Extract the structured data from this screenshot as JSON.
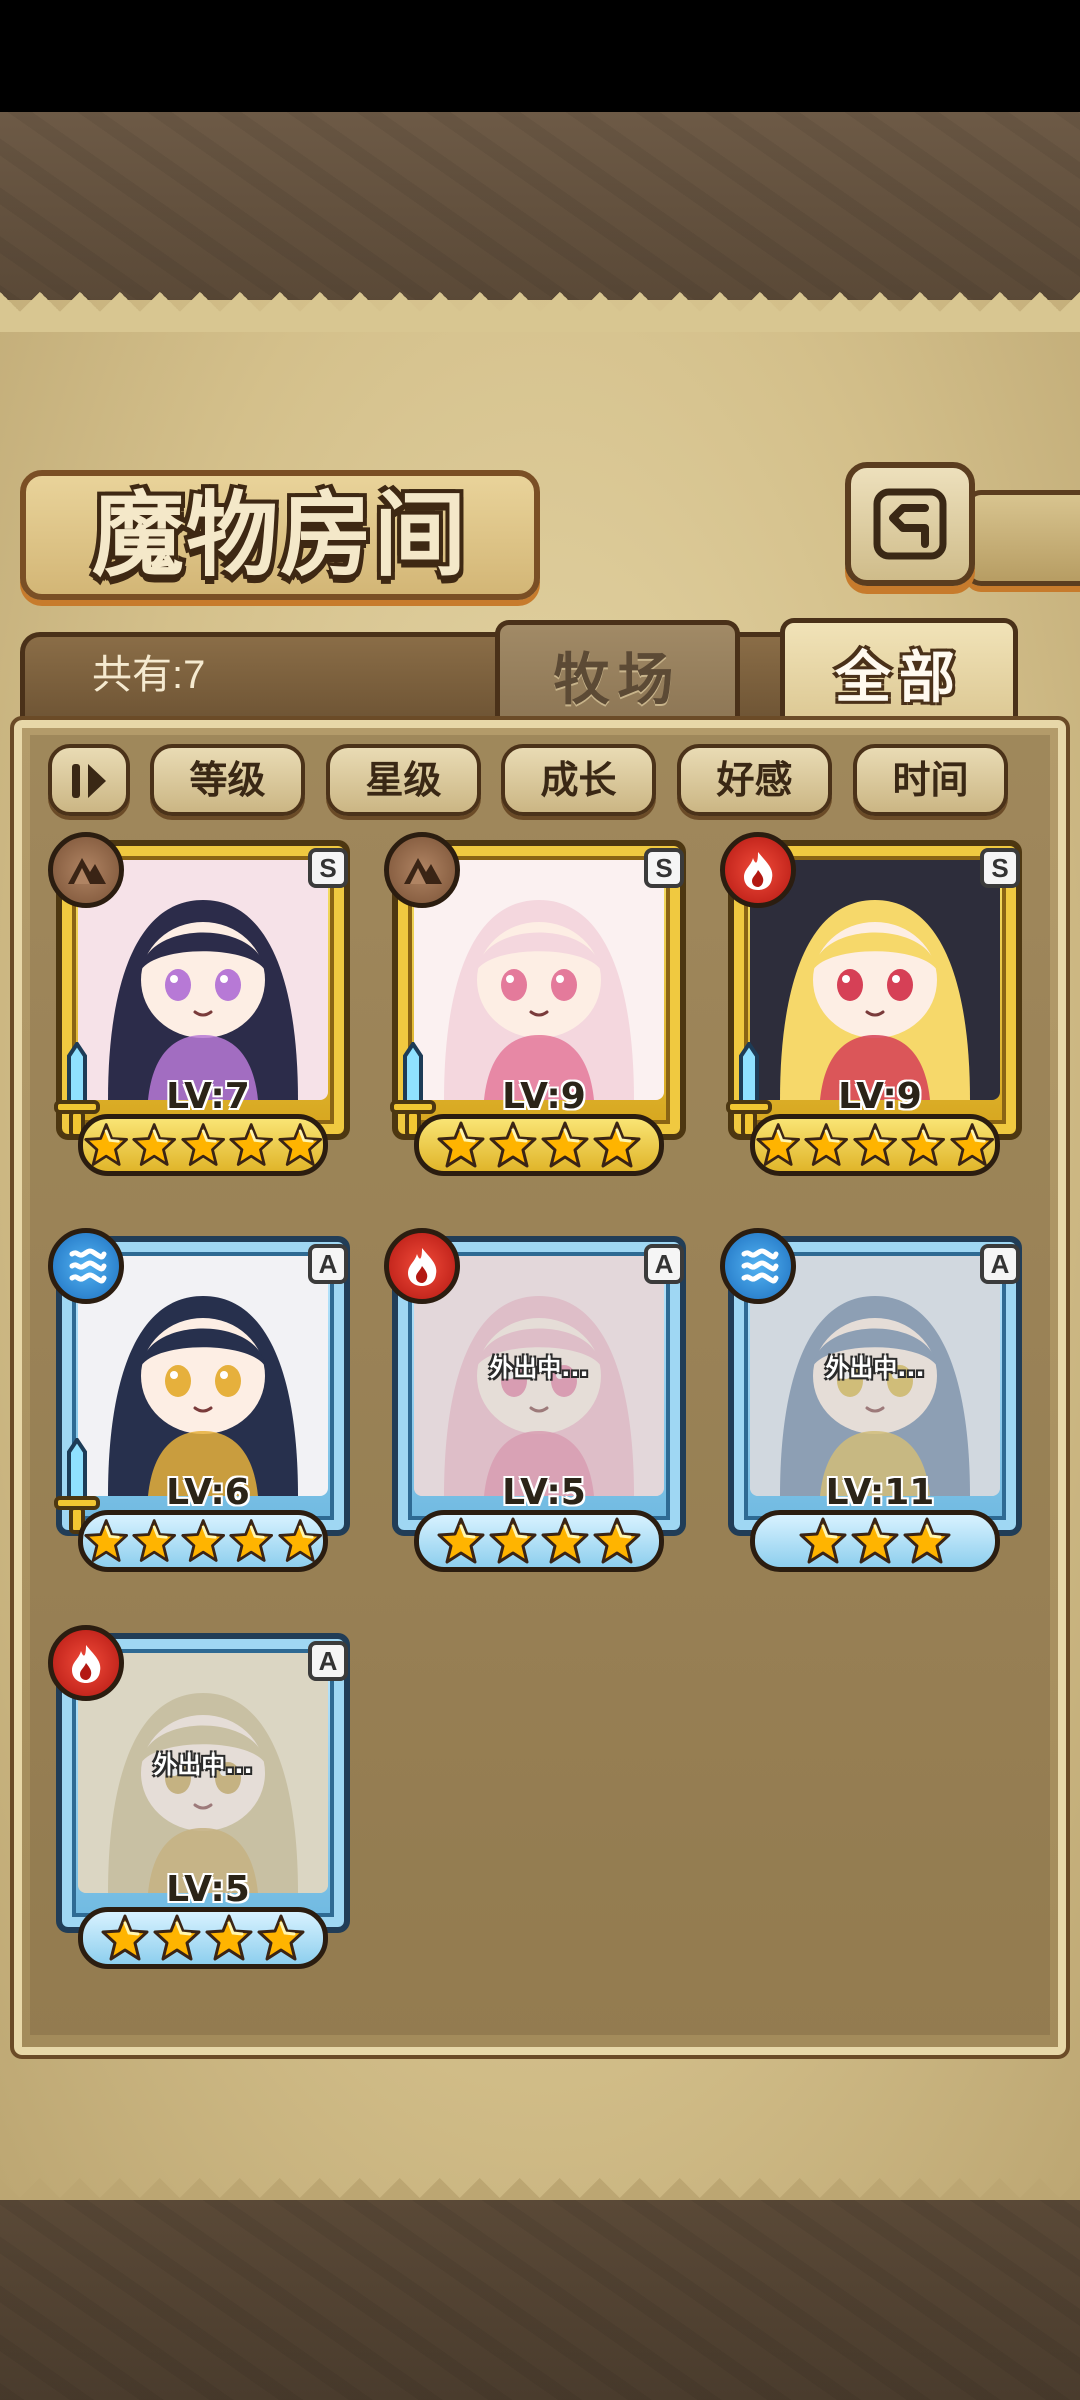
{
  "header": {
    "title": "魔物房间",
    "back_icon": "back-arrow-icon"
  },
  "count": {
    "label": "共有:7"
  },
  "tabs": [
    {
      "label": "牧场",
      "selected": false
    },
    {
      "label": "全部",
      "selected": true
    }
  ],
  "sort": {
    "toggle_icon": "sort-order-icon",
    "options": [
      "等级",
      "星级",
      "成长",
      "好感",
      "时间"
    ]
  },
  "colors": {
    "gold_frame": "#f0c940",
    "blue_frame": "#9fd7f3",
    "earth": "#7a5236",
    "fire": "#b31812",
    "water": "#1d6fbf",
    "star": "#ffb400"
  },
  "monsters": [
    {
      "level": "LV:7",
      "stars": 5,
      "rank": "S",
      "element": "earth",
      "frame": "gold",
      "equipped": true,
      "outing": ""
    },
    {
      "level": "LV:9",
      "stars": 4,
      "rank": "S",
      "element": "earth",
      "frame": "gold",
      "equipped": true,
      "outing": ""
    },
    {
      "level": "LV:9",
      "stars": 5,
      "rank": "S",
      "element": "fire",
      "frame": "gold",
      "equipped": true,
      "outing": ""
    },
    {
      "level": "LV:6",
      "stars": 5,
      "rank": "A",
      "element": "water",
      "frame": "blue",
      "equipped": true,
      "outing": ""
    },
    {
      "level": "LV:5",
      "stars": 4,
      "rank": "A",
      "element": "fire",
      "frame": "blue",
      "equipped": false,
      "outing": "外出中..."
    },
    {
      "level": "LV:11",
      "stars": 3,
      "rank": "A",
      "element": "water",
      "frame": "blue",
      "equipped": false,
      "outing": "外出中..."
    },
    {
      "level": "LV:5",
      "stars": 4,
      "rank": "A",
      "element": "fire",
      "frame": "blue",
      "equipped": false,
      "outing": "外出中..."
    }
  ]
}
